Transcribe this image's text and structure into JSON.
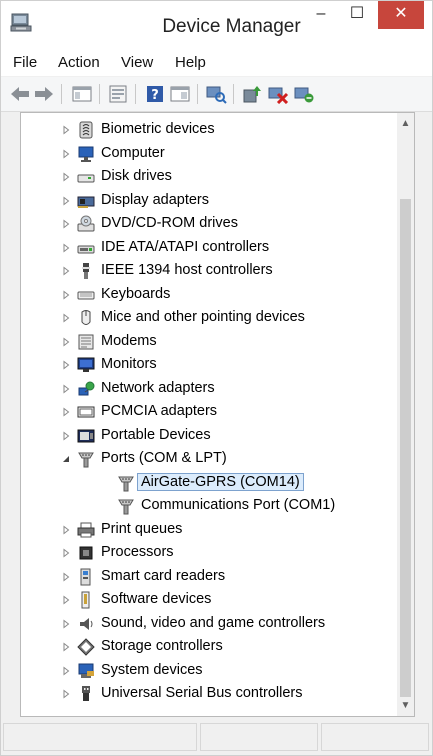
{
  "window": {
    "title": "Device Manager",
    "controls": {
      "minimize": "–",
      "maximize": "☐",
      "close": "✕"
    }
  },
  "menu": [
    "File",
    "Action",
    "View",
    "Help"
  ],
  "toolbar": {
    "buttons": [
      "back-arrow-icon",
      "forward-arrow-icon",
      "show-hide-console-tree-icon",
      "properties-icon",
      "help-icon",
      "console-tree-icon",
      "scan-hardware-icon",
      "update-driver-icon",
      "disable-device-icon",
      "uninstall-device-icon"
    ]
  },
  "tree": {
    "items": [
      {
        "label": "Biometric devices",
        "icon": "biometric-icon",
        "expanded": false,
        "level": 1
      },
      {
        "label": "Computer",
        "icon": "computer-icon",
        "expanded": false,
        "level": 1
      },
      {
        "label": "Disk drives",
        "icon": "disk-drive-icon",
        "expanded": false,
        "level": 1
      },
      {
        "label": "Display adapters",
        "icon": "display-adapter-icon",
        "expanded": false,
        "level": 1
      },
      {
        "label": "DVD/CD-ROM drives",
        "icon": "dvd-drive-icon",
        "expanded": false,
        "level": 1
      },
      {
        "label": "IDE ATA/ATAPI controllers",
        "icon": "ide-controller-icon",
        "expanded": false,
        "level": 1
      },
      {
        "label": "IEEE 1394 host controllers",
        "icon": "firewire-icon",
        "expanded": false,
        "level": 1
      },
      {
        "label": "Keyboards",
        "icon": "keyboard-icon",
        "expanded": false,
        "level": 1
      },
      {
        "label": "Mice and other pointing devices",
        "icon": "mouse-icon",
        "expanded": false,
        "level": 1
      },
      {
        "label": "Modems",
        "icon": "modem-icon",
        "expanded": false,
        "level": 1
      },
      {
        "label": "Monitors",
        "icon": "monitor-icon",
        "expanded": false,
        "level": 1
      },
      {
        "label": "Network adapters",
        "icon": "network-adapter-icon",
        "expanded": false,
        "level": 1
      },
      {
        "label": "PCMCIA adapters",
        "icon": "pcmcia-icon",
        "expanded": false,
        "level": 1
      },
      {
        "label": "Portable Devices",
        "icon": "portable-device-icon",
        "expanded": false,
        "level": 1
      },
      {
        "label": "Ports (COM & LPT)",
        "icon": "port-icon",
        "expanded": true,
        "level": 1
      },
      {
        "label": "AirGate-GPRS (COM14)",
        "icon": "port-icon",
        "level": 2,
        "selected": true
      },
      {
        "label": "Communications Port (COM1)",
        "icon": "port-icon",
        "level": 2
      },
      {
        "label": "Print queues",
        "icon": "printer-icon",
        "expanded": false,
        "level": 1
      },
      {
        "label": "Processors",
        "icon": "processor-icon",
        "expanded": false,
        "level": 1
      },
      {
        "label": "Smart card readers",
        "icon": "smart-card-reader-icon",
        "expanded": false,
        "level": 1
      },
      {
        "label": "Software devices",
        "icon": "software-device-icon",
        "expanded": false,
        "level": 1
      },
      {
        "label": "Sound, video and game controllers",
        "icon": "sound-icon",
        "expanded": false,
        "level": 1
      },
      {
        "label": "Storage controllers",
        "icon": "storage-controller-icon",
        "expanded": false,
        "level": 1
      },
      {
        "label": "System devices",
        "icon": "system-device-icon",
        "expanded": false,
        "level": 1
      },
      {
        "label": "Universal Serial Bus controllers",
        "icon": "usb-icon",
        "expanded": false,
        "level": 1
      }
    ]
  },
  "scrollbar": {
    "up": "▲",
    "down": "▼"
  },
  "colors": {
    "close_button": "#c7463c",
    "selection_bg": "#dcecfc",
    "selection_border": "#7da2ce"
  }
}
